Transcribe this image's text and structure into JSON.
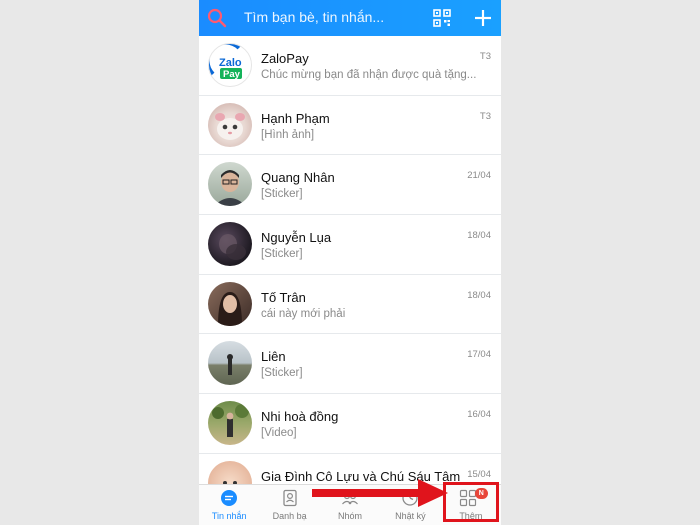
{
  "search": {
    "placeholder": "Tìm bạn bè, tin nhắn..."
  },
  "conversations": [
    {
      "name": "ZaloPay",
      "preview": "Chúc mừng bạn đã nhận được quà tặng...",
      "time": "T3"
    },
    {
      "name": "Hạnh Phạm",
      "preview": "[Hình ảnh]",
      "time": "T3"
    },
    {
      "name": "Quang Nhân",
      "preview": "[Sticker]",
      "time": "21/04"
    },
    {
      "name": "Nguyễn Lụa",
      "preview": "[Sticker]",
      "time": "18/04"
    },
    {
      "name": "Tố Trân",
      "preview": "cái này mới phải",
      "time": "18/04"
    },
    {
      "name": "Liên",
      "preview": "[Sticker]",
      "time": "17/04"
    },
    {
      "name": "Nhi hoà đồng",
      "preview": "[Video]",
      "time": "16/04"
    },
    {
      "name": "Gia Đình Cô Lựu và Chú Sáu Tâm",
      "preview": "",
      "time": "15/04"
    }
  ],
  "zalopay_logo": {
    "line1": "Zalo",
    "line2": "Pay"
  },
  "tabs": [
    {
      "label": "Tin nhắn",
      "icon": "chat-icon"
    },
    {
      "label": "Danh bạ",
      "icon": "contacts-icon"
    },
    {
      "label": "Nhóm",
      "icon": "group-icon"
    },
    {
      "label": "Nhật ký",
      "icon": "clock-icon"
    },
    {
      "label": "Thêm",
      "icon": "grid-icon",
      "badge": "N"
    }
  ],
  "colors": {
    "header_blue": "#1a8cff",
    "active_tab": "#1a8cff",
    "annotation_red": "#e0141c",
    "badge_red": "#e8463a"
  }
}
